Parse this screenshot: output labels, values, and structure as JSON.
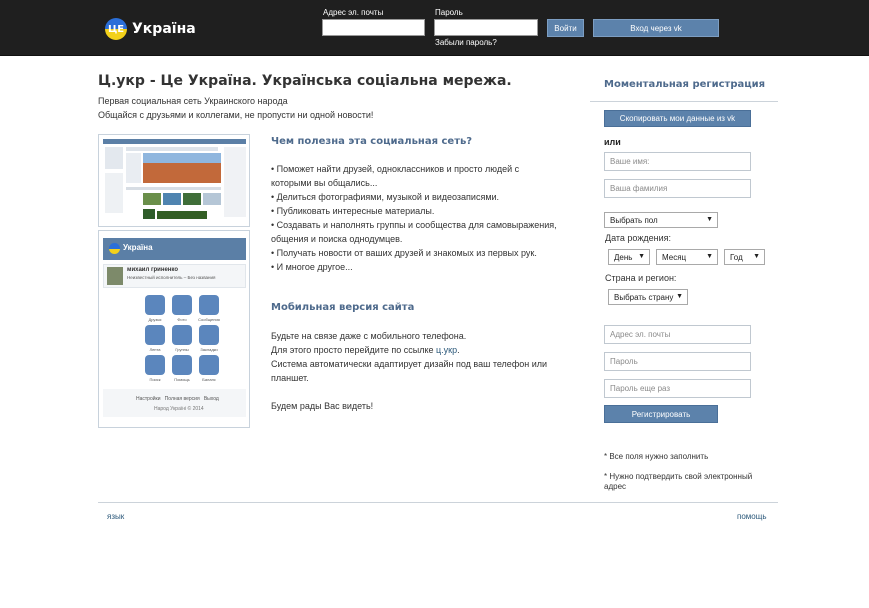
{
  "header": {
    "logo_badge": "ЦЕ",
    "logo_name": "Україна",
    "email_label": "Адрес эл. почты",
    "password_label": "Пароль",
    "login_button": "Войти",
    "forgot_link": "Забыли пароль?",
    "vk_login_button": "Вход через vk"
  },
  "main": {
    "title": "Ц.укр - Це Україна. Українська соціальна мережа.",
    "intro_line1": "Первая социальная сеть Украинского народа",
    "intro_line2": "Общайся с друзьями и коллегами, не пропусти ни одной новости!",
    "features_title": "Чем полезна эта социальная сеть?",
    "features": [
      "• Поможет найти друзей, одноклассников и просто людей с",
      "которыми вы общались...",
      "• Делиться фотографиями, музыкой и видеозаписями.",
      "• Публиковать интересные материалы.",
      "• Создавать и наполнять группы и сообщества для самовыражения,",
      "общения и поиска однодумцев.",
      "• Получать новости от ваших друзей и знакомых из первых рук.",
      "• И многое другое..."
    ],
    "mobile_title": "Мобильная версия сайта",
    "mobile_line1": "Будьте на связе даже с мобильного телефона.",
    "mobile_line2_prefix": "Для этого просто перейдите по ссылке ",
    "mobile_link": "ц.укр",
    "mobile_line2_suffix": ".",
    "mobile_line3": "Система автоматически адаптирует дизайн под ваш телефон или",
    "mobile_line4": "планшет.",
    "closing": "Будем рады Вас видеть!"
  },
  "preview_mobile": {
    "logo_badge": "ЦЕ",
    "logo_name": "Україна",
    "user_name": "михаил гриненко",
    "user_status": "Неизвестный исполнитель – Без названия",
    "tiles": [
      "Друзья",
      "Фото",
      "Сообщения",
      "Лента",
      "Группы",
      "Закладки",
      "Поиск",
      "Помощь",
      "Баланс"
    ],
    "footer_links": "Настройки   Полная версия   Выход",
    "copyright": "Народ Україні © 2014"
  },
  "registration": {
    "title": "Моментальная регистрация",
    "copy_vk_button": "Скопировать мои данные из vk",
    "or_label": "или",
    "first_name_placeholder": "Ваше имя:",
    "last_name_placeholder": "Ваша фамилия",
    "gender_select": "Выбрать пол",
    "birthdate_label": "Дата рождения:",
    "day_select": "День",
    "month_select": "Месяц",
    "year_select": "Год",
    "country_label": "Страна и регион:",
    "country_select": "Выбрать страну",
    "email_placeholder": "Адрес эл. почты",
    "password_placeholder": "Пароль",
    "password_repeat_placeholder": "Пароль еще раз",
    "register_button": "Регистрировать",
    "note1": "* Все поля нужно заполнить",
    "note2_line1": "* Нужно подтвердить свой электронный",
    "note2_line2": "адрес"
  },
  "footer": {
    "language_link": "язык",
    "help_link": "помощь"
  },
  "colors": {
    "header_bg": "#1f1f1f",
    "accent": "#5c82ab",
    "heading": "#4e6a8c",
    "link": "#2b587a"
  }
}
